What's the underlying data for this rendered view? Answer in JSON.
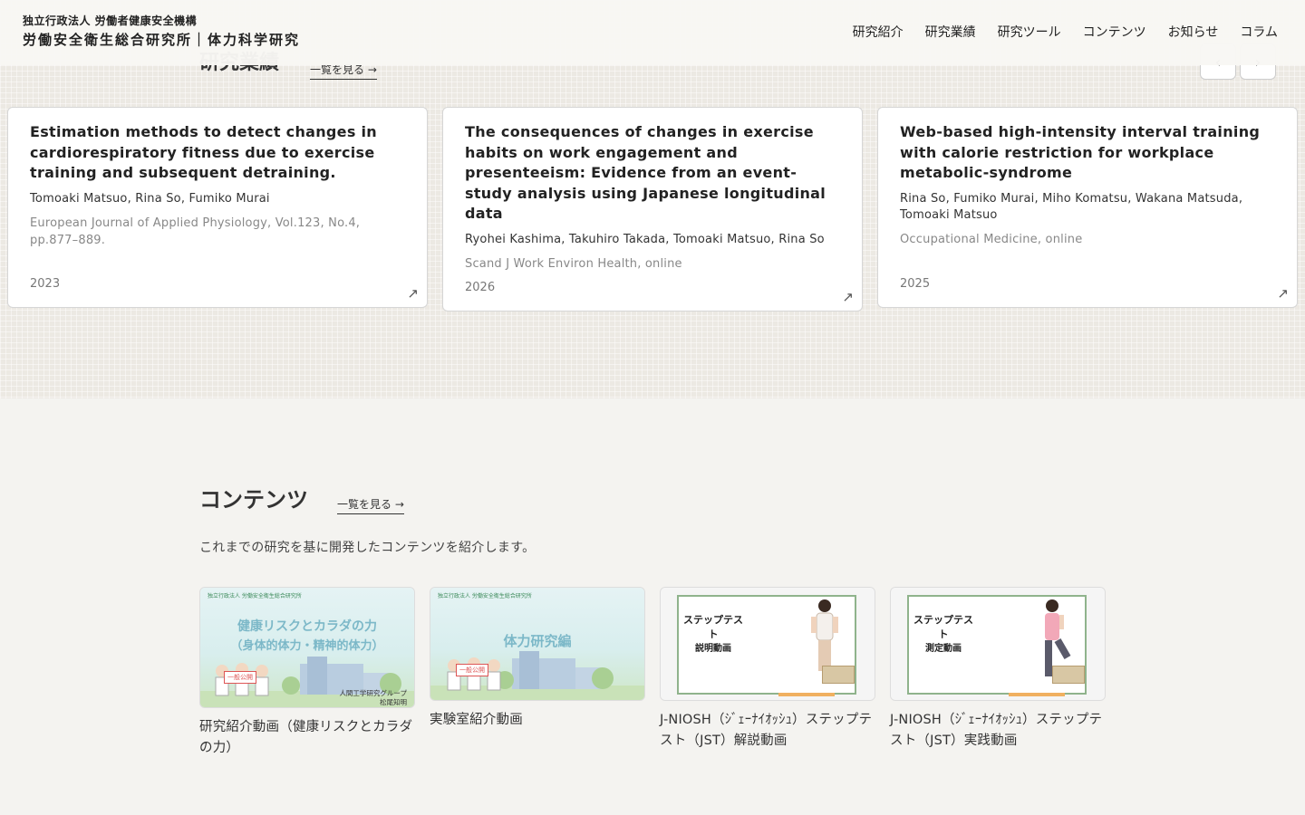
{
  "header": {
    "org_sub": "独立行政法人 労働者健康安全機構",
    "org_main": "労働安全衛生総合研究所｜体力科学研究",
    "nav": [
      "研究紹介",
      "研究業績",
      "研究ツール",
      "コンテンツ",
      "お知らせ",
      "コラム"
    ]
  },
  "achievements": {
    "title": "研究業績",
    "more_label": "一覧を見る →",
    "prev_label": "‹",
    "next_label": "›",
    "cards": [
      {
        "title": "Estimation methods to detect changes in cardiorespiratory fitness due to exercise training and subsequent detraining.",
        "authors": "Tomoaki Matsuo, Rina So, Fumiko Murai",
        "journal": "European Journal of Applied Physiology, Vol.123, No.4, pp.877–889.",
        "year": "2023",
        "arrow": "↗"
      },
      {
        "title": "The consequences of changes in exercise habits on work engagement and presenteeism: Evidence from an event-study analysis using Japanese longitudinal data",
        "authors": "Ryohei Kashima, Takuhiro Takada, Tomoaki Matsuo, Rina So",
        "journal": "Scand J Work Environ Health, online",
        "year": "2026",
        "arrow": "↗"
      },
      {
        "title": "Web-based high-intensity interval training with calorie restriction for workplace metabolic-syndrome",
        "authors": "Rina So, Fumiko Murai, Miho Komatsu, Wakana Matsuda, Tomoaki Matsuo",
        "journal": "Occupational Medicine, online",
        "year": "2025",
        "arrow": "↗"
      }
    ]
  },
  "contents": {
    "title": "コンテンツ",
    "more_label": "一覧を見る →",
    "description": "これまでの研究を基に開発したコンテンツを紹介します。",
    "items": [
      {
        "label": "研究紹介動画（健康リスクとカラダの力）",
        "thumb_org": "独立行政法人 労働安全衛生総合研究所",
        "thumb_head1": "健康リスクとカラダの力",
        "thumb_head2": "（身体的体力・精神的体力）",
        "thumb_sign": "一般公開",
        "thumb_foot1": "人間工学研究グループ",
        "thumb_foot2": "松尾知明"
      },
      {
        "label": "実験室紹介動画",
        "thumb_org": "独立行政法人 労働安全衛生総合研究所",
        "thumb_head1": "体力研究編",
        "thumb_sign": "一般公開"
      },
      {
        "label": "J-NIOSH（ｼﾞｪｰﾅｲｵｯｼｭ）ステップテスト（JST）解説動画",
        "thumb_title": "ステップテスト",
        "thumb_sub": "説明動画"
      },
      {
        "label": "J-NIOSH（ｼﾞｪｰﾅｲｵｯｼｭ）ステップテスト（JST）実践動画",
        "thumb_title": "ステップテスト",
        "thumb_sub": "測定動画"
      }
    ]
  },
  "colors": {
    "accent_green": "#8fb38c",
    "sign_red": "#dd5555",
    "box_orange": "#f0b060"
  }
}
